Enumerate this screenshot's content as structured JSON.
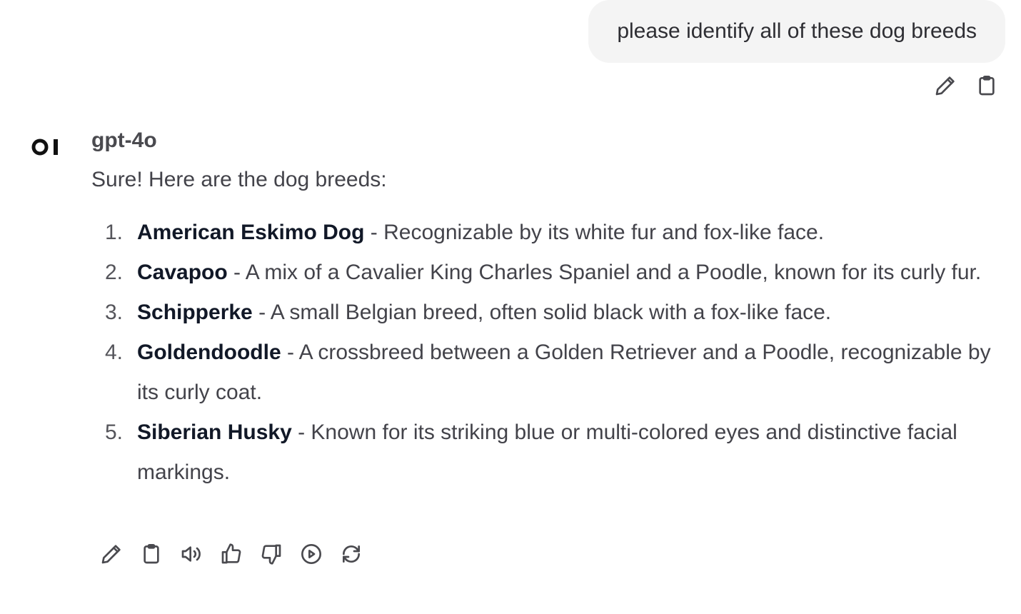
{
  "user_message": {
    "text": "please identify all of these dog breeds",
    "actions": [
      "edit-icon",
      "copy-icon"
    ]
  },
  "assistant": {
    "avatar_text": "OI",
    "model": "gpt-4o",
    "intro": "Sure! Here are the dog breeds:",
    "items": [
      {
        "number": "1.",
        "breed": "American Eskimo Dog",
        "desc": " - Recognizable by its white fur and fox-like face."
      },
      {
        "number": "2.",
        "breed": "Cavapoo",
        "desc": " - A mix of a Cavalier King Charles Spaniel and a Poodle, known for its curly fur."
      },
      {
        "number": "3.",
        "breed": "Schipperke",
        "desc": " - A small Belgian breed, often solid black with a fox-like face."
      },
      {
        "number": "4.",
        "breed": "Goldendoodle",
        "desc": " - A crossbreed between a Golden Retriever and a Poodle, recognizable by its curly coat."
      },
      {
        "number": "5.",
        "breed": "Siberian Husky",
        "desc": " - Known for its striking blue or multi-colored eyes and distinctive facial markings."
      }
    ],
    "actions": [
      "edit-icon",
      "copy-icon",
      "read-aloud-icon",
      "thumbs-up-icon",
      "thumbs-down-icon",
      "play-icon",
      "regenerate-icon"
    ]
  },
  "colors": {
    "bubble_bg": "#f4f4f4",
    "breed_text": "#111827",
    "body_text": "#43434a"
  }
}
